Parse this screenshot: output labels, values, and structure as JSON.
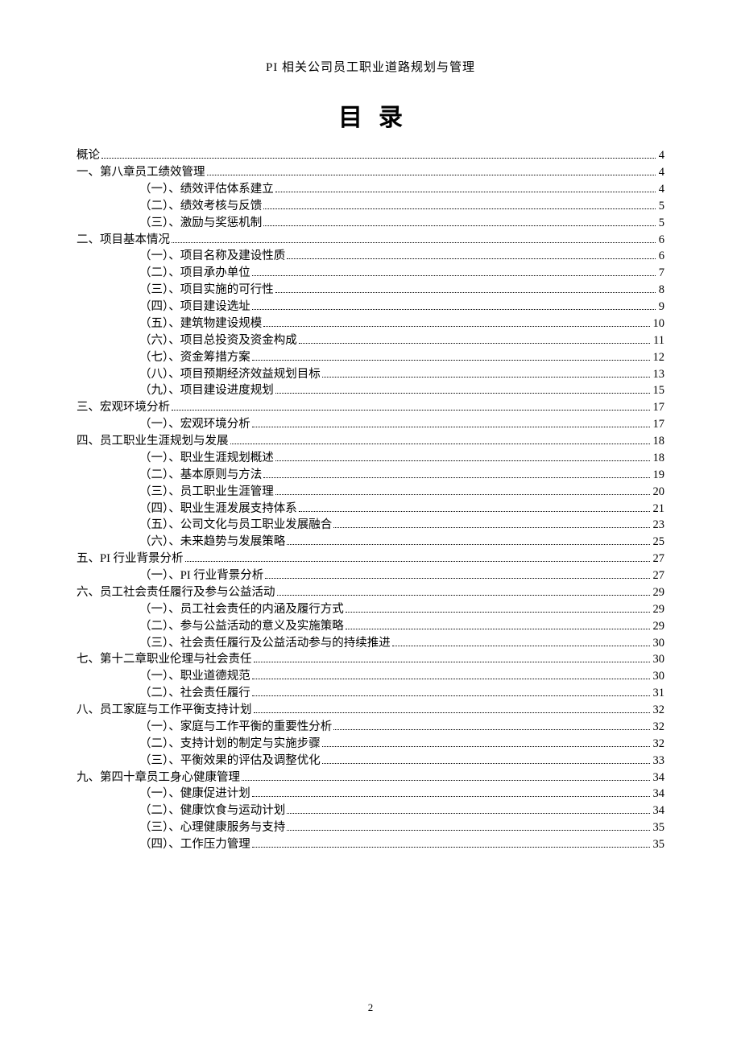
{
  "header": "PI 相关公司员工职业道路规划与管理",
  "title": "目录",
  "footerPage": "2",
  "toc": [
    {
      "level": 0,
      "label": "概论",
      "page": "4"
    },
    {
      "level": 0,
      "label": "一、第八章员工绩效管理",
      "page": "4"
    },
    {
      "level": 1,
      "label": "（一）、绩效评估体系建立",
      "page": "4"
    },
    {
      "level": 1,
      "label": "（二）、绩效考核与反馈",
      "page": "5"
    },
    {
      "level": 1,
      "label": "（三）、激励与奖惩机制",
      "page": "5"
    },
    {
      "level": 0,
      "label": "二、项目基本情况",
      "page": "6"
    },
    {
      "level": 1,
      "label": "（一）、项目名称及建设性质",
      "page": "6"
    },
    {
      "level": 1,
      "label": "（二）、项目承办单位",
      "page": "7"
    },
    {
      "level": 1,
      "label": "（三）、项目实施的可行性",
      "page": "8"
    },
    {
      "level": 1,
      "label": "（四）、项目建设选址",
      "page": "9"
    },
    {
      "level": 1,
      "label": "（五）、建筑物建设规模",
      "page": "10"
    },
    {
      "level": 1,
      "label": "（六）、项目总投资及资金构成",
      "page": "11"
    },
    {
      "level": 1,
      "label": "（七）、资金筹措方案",
      "page": "12"
    },
    {
      "level": 1,
      "label": "（八）、项目预期经济效益规划目标",
      "page": "13"
    },
    {
      "level": 1,
      "label": "（九）、项目建设进度规划",
      "page": "15"
    },
    {
      "level": 0,
      "label": "三、宏观环境分析",
      "page": "17"
    },
    {
      "level": 1,
      "label": "（一）、宏观环境分析",
      "page": "17"
    },
    {
      "level": 0,
      "label": "四、员工职业生涯规划与发展",
      "page": "18"
    },
    {
      "level": 1,
      "label": "（一）、职业生涯规划概述",
      "page": "18"
    },
    {
      "level": 1,
      "label": "（二）、基本原则与方法",
      "page": "19"
    },
    {
      "level": 1,
      "label": "（三）、员工职业生涯管理",
      "page": "20"
    },
    {
      "level": 1,
      "label": "（四）、职业生涯发展支持体系",
      "page": "21"
    },
    {
      "level": 1,
      "label": "（五）、公司文化与员工职业发展融合",
      "page": "23"
    },
    {
      "level": 1,
      "label": "（六）、未来趋势与发展策略",
      "page": "25"
    },
    {
      "level": 0,
      "label": "五、PI 行业背景分析",
      "page": "27"
    },
    {
      "level": 1,
      "label": "（一）、PI 行业背景分析",
      "page": "27"
    },
    {
      "level": 0,
      "label": "六、员工社会责任履行及参与公益活动",
      "page": "29"
    },
    {
      "level": 1,
      "label": "（一）、员工社会责任的内涵及履行方式",
      "page": "29"
    },
    {
      "level": 1,
      "label": "（二）、参与公益活动的意义及实施策略",
      "page": "29"
    },
    {
      "level": 1,
      "label": "（三）、社会责任履行及公益活动参与的持续推进",
      "page": "30"
    },
    {
      "level": 0,
      "label": "七、第十二章职业伦理与社会责任",
      "page": "30"
    },
    {
      "level": 1,
      "label": "（一）、职业道德规范",
      "page": "30"
    },
    {
      "level": 1,
      "label": "（二）、社会责任履行",
      "page": "31"
    },
    {
      "level": 0,
      "label": "八、员工家庭与工作平衡支持计划",
      "page": "32"
    },
    {
      "level": 1,
      "label": "（一）、家庭与工作平衡的重要性分析",
      "page": "32"
    },
    {
      "level": 1,
      "label": "（二）、支持计划的制定与实施步骤",
      "page": "32"
    },
    {
      "level": 1,
      "label": "（三）、平衡效果的评估及调整优化",
      "page": "33"
    },
    {
      "level": 0,
      "label": "九、第四十章员工身心健康管理",
      "page": "34"
    },
    {
      "level": 1,
      "label": "（一）、健康促进计划",
      "page": "34"
    },
    {
      "level": 1,
      "label": "（二）、健康饮食与运动计划",
      "page": "34"
    },
    {
      "level": 1,
      "label": "（三）、心理健康服务与支持",
      "page": "35"
    },
    {
      "level": 1,
      "label": "（四）、工作压力管理",
      "page": "35"
    }
  ]
}
